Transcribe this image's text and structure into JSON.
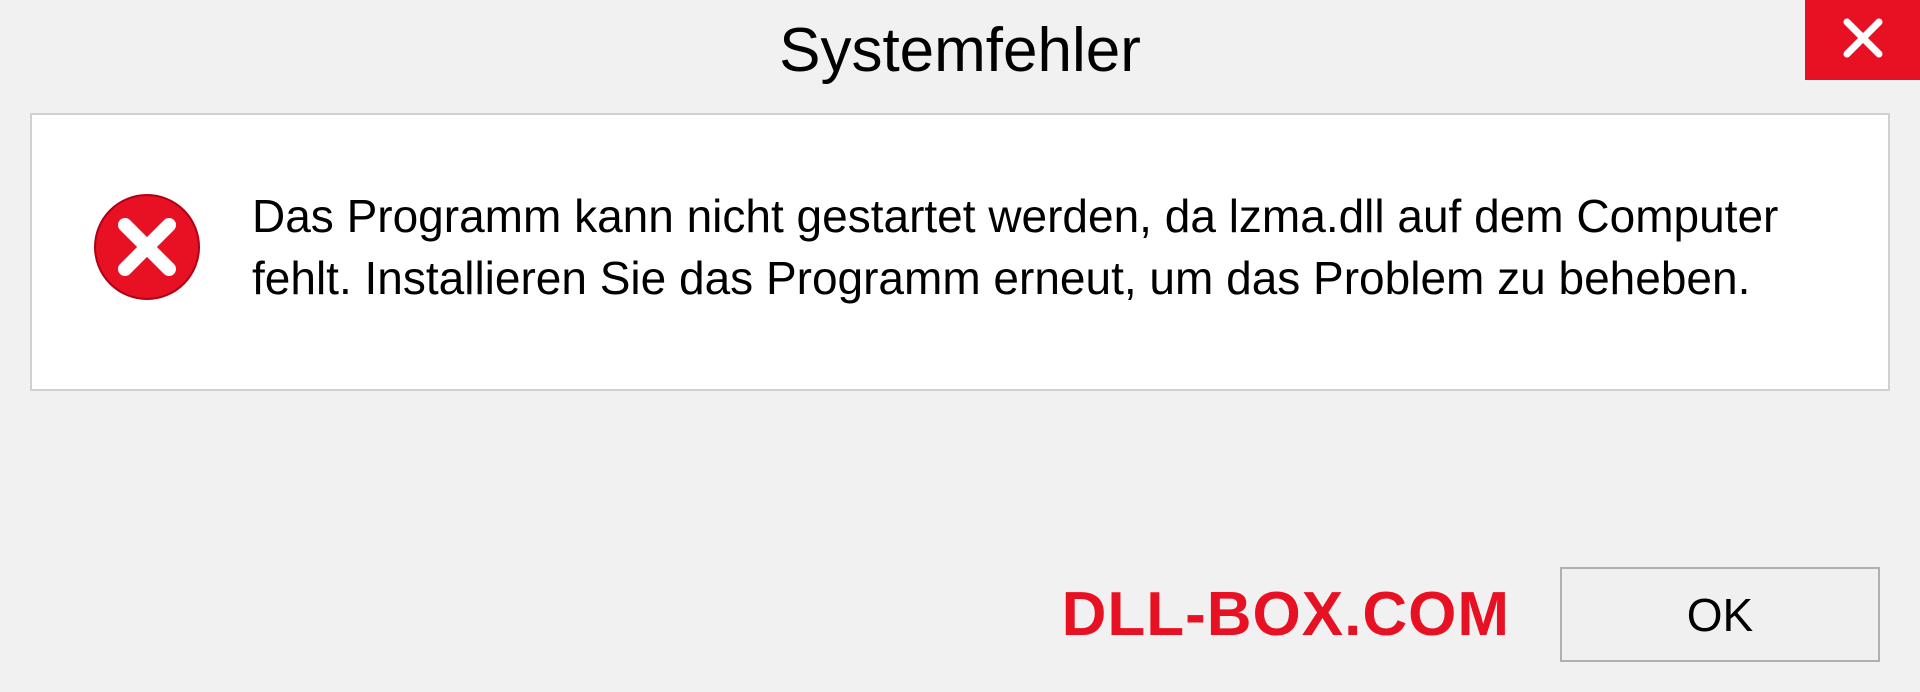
{
  "dialog": {
    "title": "Systemfehler",
    "message": "Das Programm kann nicht gestartet werden, da lzma.dll auf dem Computer fehlt. Installieren Sie das Programm erneut, um das Problem zu beheben.",
    "ok_label": "OK"
  },
  "watermark": "DLL-BOX.COM",
  "colors": {
    "close_bg": "#e81123",
    "error_icon": "#e81123",
    "watermark": "#e81123"
  }
}
